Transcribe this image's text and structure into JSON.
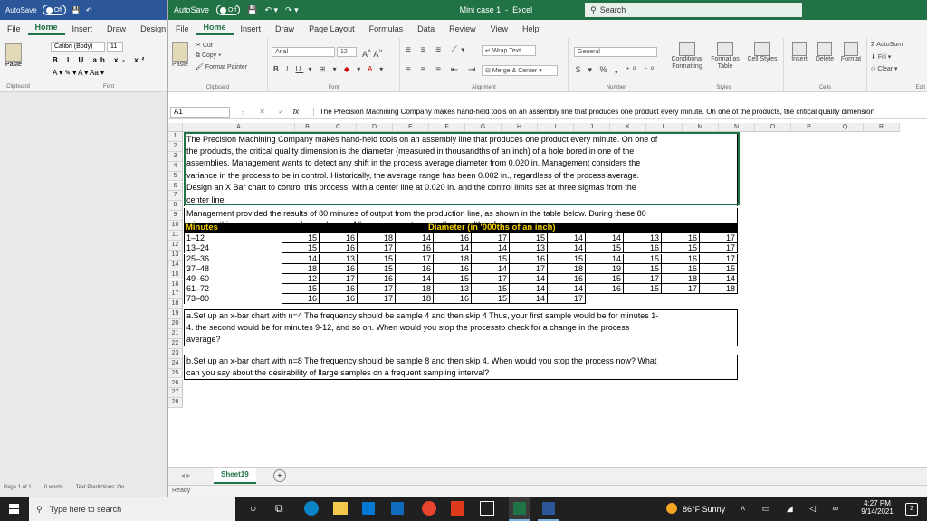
{
  "left_app": {
    "autosave": "AutoSave",
    "toggle": "Off",
    "menu": [
      "File",
      "Home",
      "Insert",
      "Draw",
      "Design"
    ],
    "font_name": "Calibri (Body)",
    "font_size": "11",
    "paste": "Paste",
    "clipboard": "Clipboard",
    "font": "Font",
    "status": {
      "page": "Page 1 of 1",
      "words": "0 words",
      "predictions": "Text Predictions: On"
    }
  },
  "excel": {
    "autosave": "AutoSave",
    "toggle": "Off",
    "title_file": "Mini case 1",
    "title_app": "Excel",
    "search": "Search",
    "menu": [
      "File",
      "Home",
      "Insert",
      "Draw",
      "Page Layout",
      "Formulas",
      "Data",
      "Review",
      "View",
      "Help"
    ],
    "ribbon": {
      "paste": "Paste",
      "cut": "Cut",
      "copy": "Copy",
      "format_painter": "Format Painter",
      "clipboard": "Clipboard",
      "font_name": "Arial",
      "font_size": "12",
      "font": "Font",
      "wrap_text": "Wrap Text",
      "merge_center": "Merge & Center",
      "alignment": "Alignment",
      "number_format": "General",
      "number": "Number",
      "conditional": "Conditional Formatting",
      "format_table": "Format as Table",
      "cell_styles": "Cell Styles",
      "styles": "Styles",
      "insert": "Insert",
      "delete": "Delete",
      "format": "Format",
      "cells": "Cells",
      "autosum": "AutoSum",
      "fill": "Fill",
      "clear": "Clear",
      "editing": "Edit"
    },
    "name_box": "A1",
    "fx": "fx",
    "formula_text": "The Precision Machining Company makes hand-held tools on an assembly line that produces one product every minute. On one of the products, the critical quality dimension",
    "columns": [
      "A",
      "B",
      "C",
      "D",
      "E",
      "F",
      "G",
      "H",
      "I",
      "J",
      "K",
      "L",
      "M",
      "N",
      "O",
      "P",
      "Q",
      "R"
    ],
    "rows": [
      "1",
      "2",
      "3",
      "4",
      "5",
      "6",
      "7",
      "8",
      "9",
      "10",
      "11",
      "12",
      "13",
      "14",
      "15",
      "16",
      "17",
      "18",
      "19",
      "20",
      "21",
      "22",
      "23",
      "24",
      "25",
      "26",
      "27",
      "28"
    ],
    "para1": [
      "The Precision Machining Company makes hand-held tools on an assembly line that produces one product every minute. On one of",
      "the products, the critical quality dimension is the diameter (measured in thousandths of an inch) of a hole bored in one of the",
      "assemblies. Management wants to detect any shift in the process average diameter from 0.020 in. Management considers the",
      "variance in the process to be in control. Historically, the average range has been 0.002 in., regardless of the process average.",
      "Design an X Bar chart to control this process, with a center line at 0.020 in. and the control limits set at three sigmas from the",
      "center line."
    ],
    "para2": [
      "Management provided the results of 80 minutes of output from the production line, as shown in the table below. During these 80",
      "minutes, this process average changed once. All measurements are in thousandths of an inch."
    ],
    "table_header_left": "Minutes",
    "table_header_right": "Diameter (in '000ths of an inch)",
    "table_rows": [
      {
        "label": "1–12",
        "values": [
          "15",
          "16",
          "18",
          "14",
          "16",
          "17",
          "15",
          "14",
          "14",
          "13",
          "16",
          "17"
        ]
      },
      {
        "label": "13–24",
        "values": [
          "15",
          "16",
          "17",
          "16",
          "14",
          "14",
          "13",
          "14",
          "15",
          "16",
          "15",
          "17"
        ]
      },
      {
        "label": "25–36",
        "values": [
          "14",
          "13",
          "15",
          "17",
          "18",
          "15",
          "16",
          "15",
          "14",
          "15",
          "16",
          "17"
        ]
      },
      {
        "label": "37–48",
        "values": [
          "18",
          "16",
          "15",
          "16",
          "16",
          "14",
          "17",
          "18",
          "19",
          "15",
          "16",
          "15"
        ]
      },
      {
        "label": "49–60",
        "values": [
          "12",
          "17",
          "16",
          "14",
          "15",
          "17",
          "14",
          "16",
          "15",
          "17",
          "18",
          "14"
        ]
      },
      {
        "label": "61–72",
        "values": [
          "15",
          "16",
          "17",
          "18",
          "13",
          "15",
          "14",
          "14",
          "16",
          "15",
          "17",
          "18"
        ]
      },
      {
        "label": "73–80",
        "values": [
          "16",
          "16",
          "17",
          "18",
          "16",
          "15",
          "14",
          "17"
        ]
      }
    ],
    "qa": [
      "a.Set up an x-bar chart with n=4 The frequency should be sample 4 and then skip 4 Thus, your first sample would be for minutes 1-",
      "4.  the second would be for minutes 9-12, and so on. When would you stop the processto check for a change in the process",
      "average?"
    ],
    "qb": [
      "b.Set up an x-bar chart with n=8 The frequency should be sample 8 and then skip 4. When would you stop the process now? What",
      "can you say about the desirability of llarge samples on a frequent sampling interval?"
    ],
    "sheet_tab": "Sheet19",
    "status_ready": "Ready"
  },
  "taskbar": {
    "search": "Type here to search",
    "weather": "86°F  Sunny",
    "time": "4:27 PM",
    "date": "9/14/2021",
    "notif": "2"
  },
  "colors": {
    "excel_green": "#217346",
    "word_blue": "#2b579a",
    "taskbar": "#202020"
  }
}
